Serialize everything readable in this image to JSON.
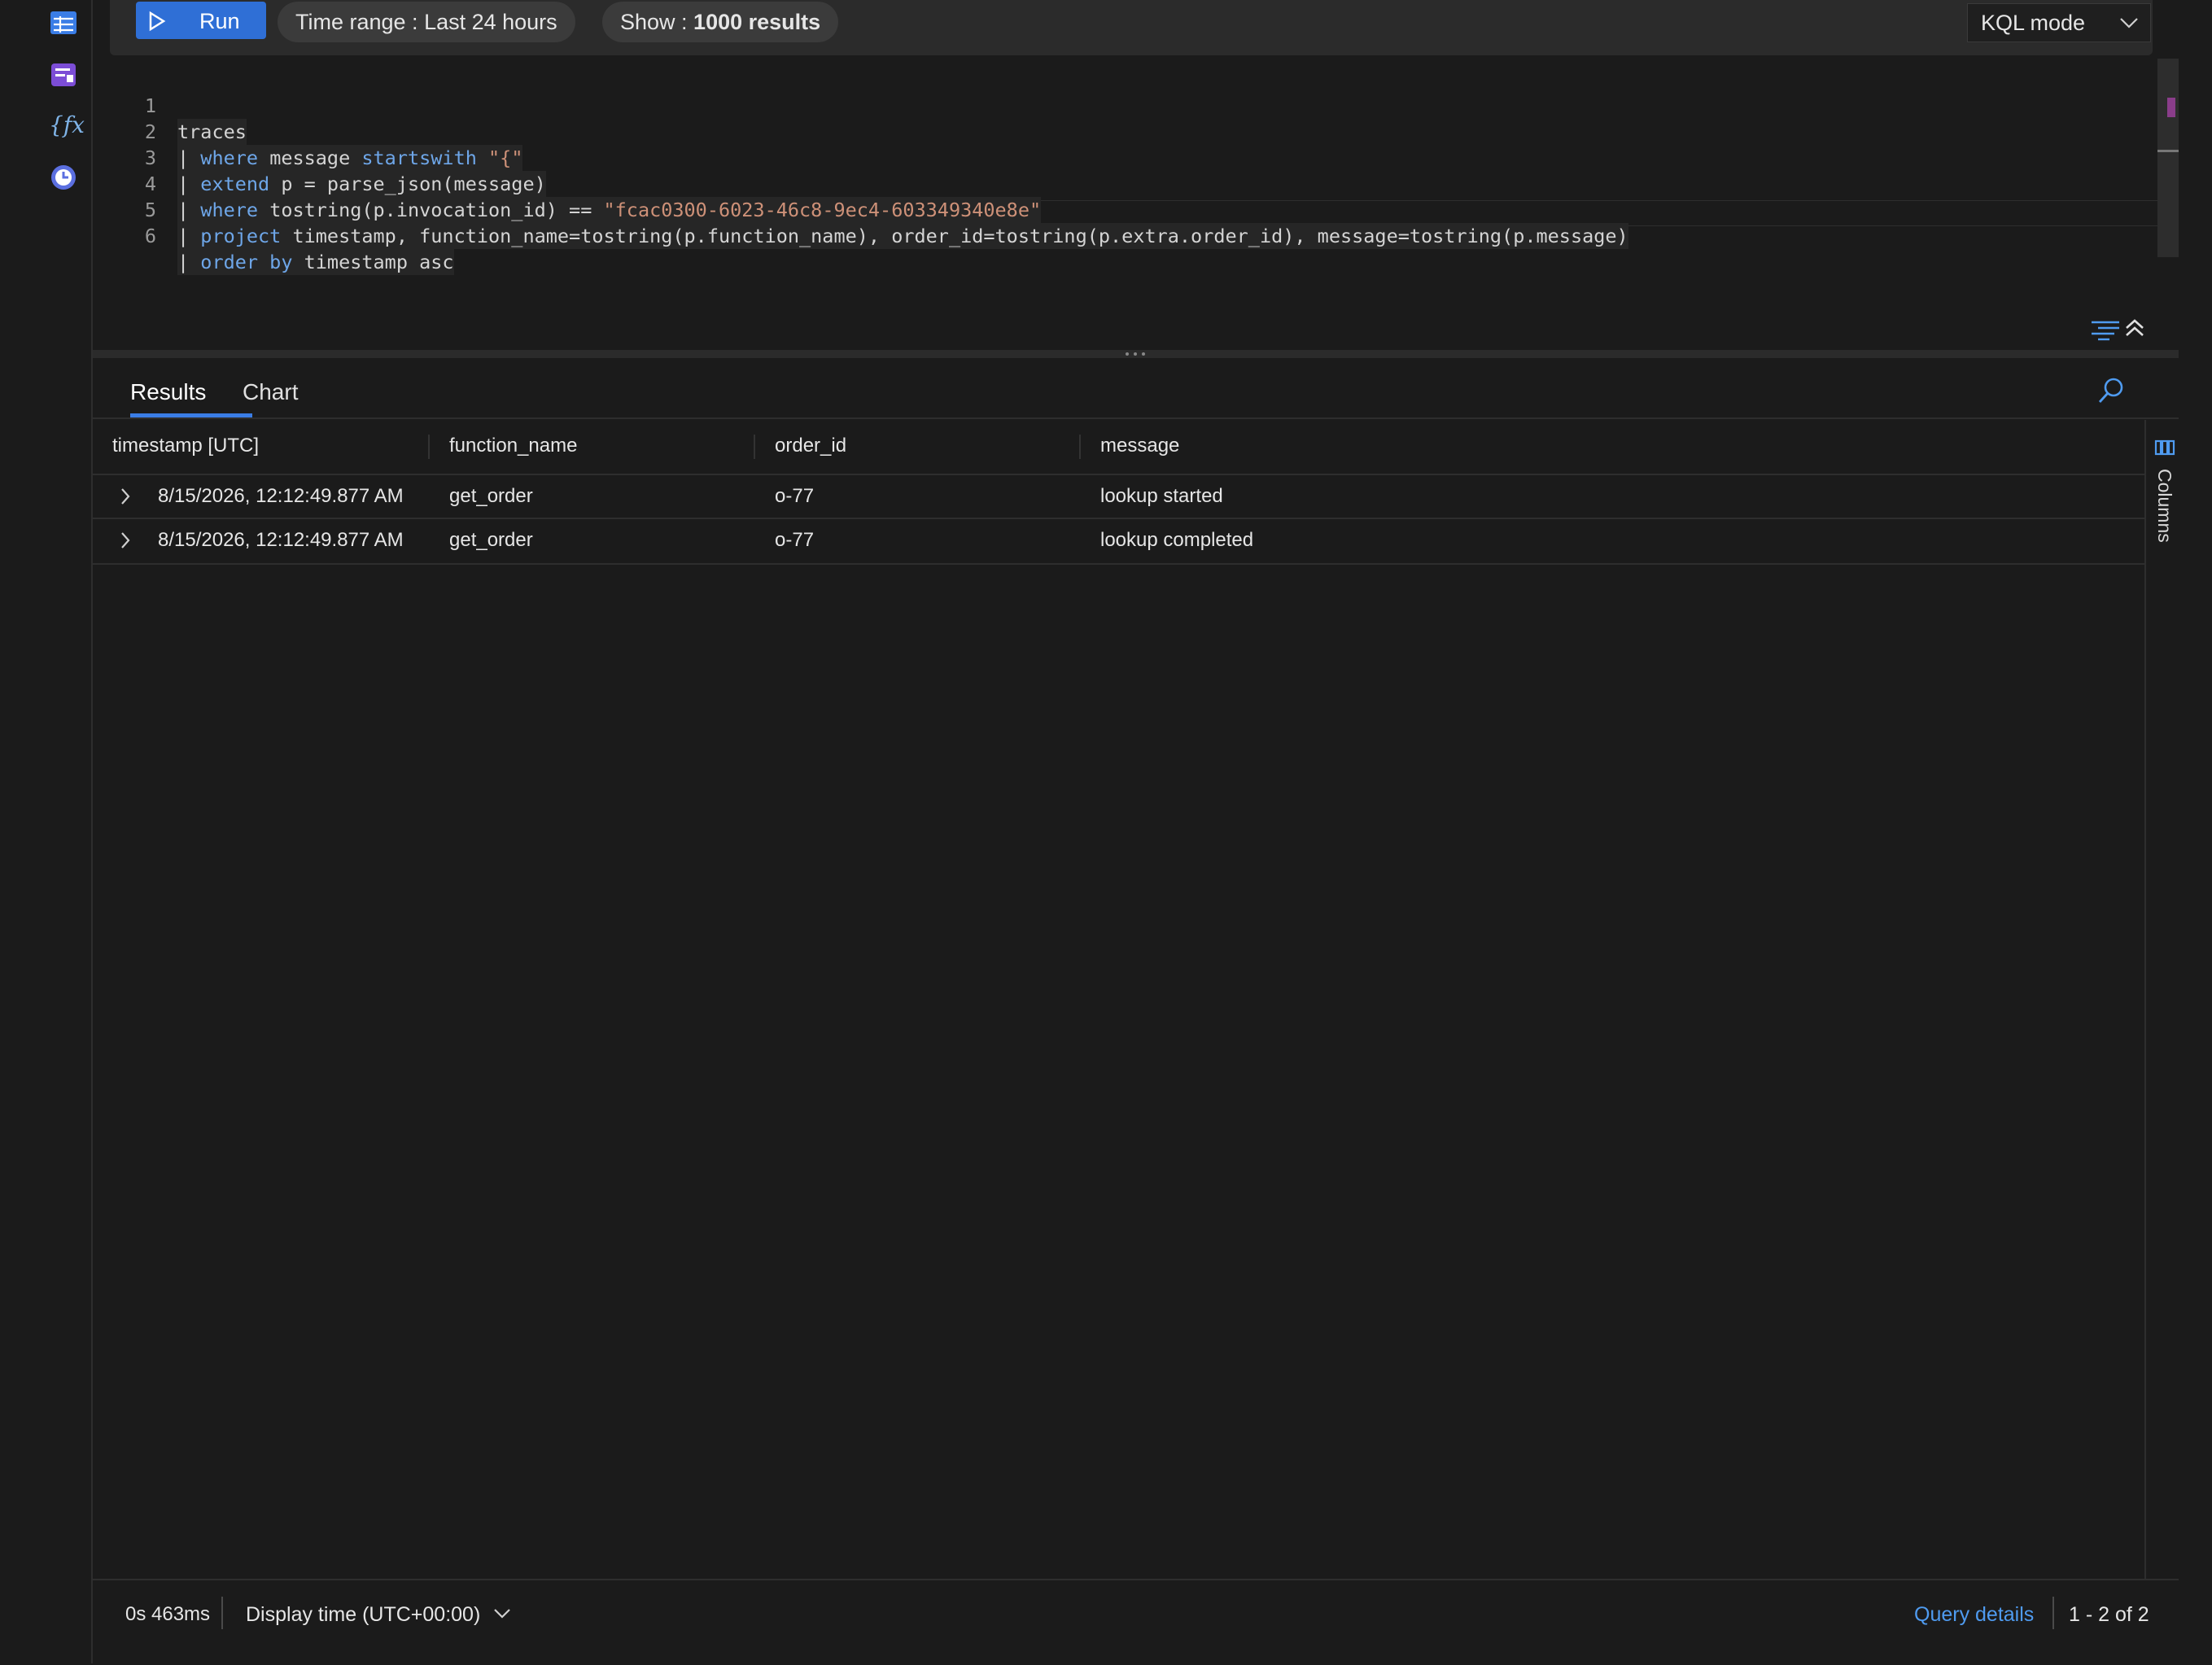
{
  "toolbar": {
    "run_label": "Run",
    "time_range_label": "Time range : ",
    "time_range_value": "Last 24 hours",
    "show_label": "Show : ",
    "show_value": "1000 results",
    "mode_label": "KQL mode"
  },
  "editor": {
    "lines": [
      {
        "n": "1"
      },
      {
        "n": "2"
      },
      {
        "n": "3"
      },
      {
        "n": "4"
      },
      {
        "n": "5"
      },
      {
        "n": "6"
      }
    ],
    "tokens": {
      "l1": "traces",
      "pipe": "| ",
      "where": "where",
      "l2_mid": " message ",
      "startswith": "startswith",
      "l2_str": " \"{\"",
      "extend": "extend",
      "l3_rest": " p = parse_json(message)",
      "l4_mid": " tostring(p.invocation_id) == ",
      "l4_str": "\"fcac0300-6023-46c8-9ec4-603349340e8e\"",
      "project": "project",
      "l5_rest": " timestamp, function_name=tostring(p.function_name), order_id=tostring(p.extra.order_id), message=tostring(p.message)",
      "order_by": "order by",
      "l6_rest": " timestamp asc"
    }
  },
  "results": {
    "tabs": [
      {
        "label": "Results",
        "active": true
      },
      {
        "label": "Chart",
        "active": false
      }
    ],
    "columns": [
      "timestamp [UTC]",
      "function_name",
      "order_id",
      "message"
    ],
    "rows": [
      {
        "timestamp": "8/15/2026, 12:12:49.877 AM",
        "function_name": "get_order",
        "order_id": "o-77",
        "message": "lookup started"
      },
      {
        "timestamp": "8/15/2026, 12:12:49.877 AM",
        "function_name": "get_order",
        "order_id": "o-77",
        "message": "lookup completed"
      }
    ],
    "columns_panel_label": "Columns"
  },
  "status": {
    "duration": "0s 463ms",
    "display_time": "Display time (UTC+00:00)",
    "query_details": "Query details",
    "range": "1 - 2 of 2"
  },
  "colors": {
    "accent": "#2f6fd6",
    "link": "#4f9bf0",
    "keyword": "#6ea6e8",
    "string": "#ce9178",
    "background": "#1b1b1b"
  }
}
